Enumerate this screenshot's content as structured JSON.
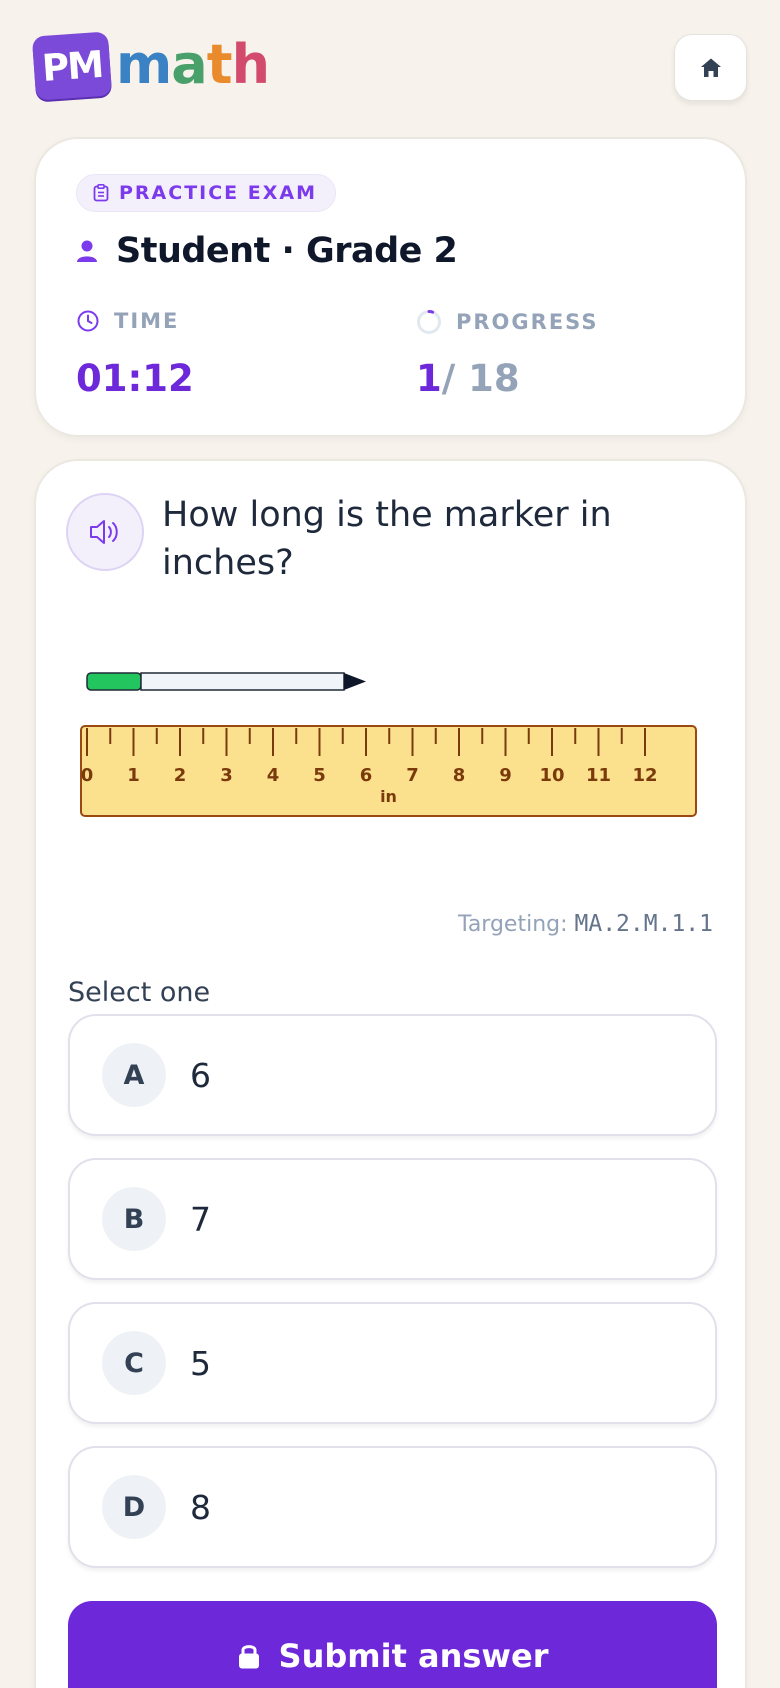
{
  "header": {
    "logo_badge": "PM",
    "logo_word": [
      "m",
      "a",
      "t",
      "h"
    ],
    "home_icon": "home-icon"
  },
  "exam": {
    "type_label": "PRACTICE EXAM",
    "student": "Student · Grade 2",
    "time_label": "TIME",
    "time_value": "01:12",
    "progress_label": "PROGRESS",
    "progress_current": "1",
    "progress_total": "/ 18",
    "progress_fraction": 0.056
  },
  "question": {
    "text": "How long is the marker in inches?",
    "ruler_unit": "in",
    "ruler_ticks": [
      "0",
      "1",
      "2",
      "3",
      "4",
      "5",
      "6",
      "7",
      "8",
      "9",
      "10",
      "11",
      "12"
    ],
    "marker_length_in": 6,
    "targeting_label": "Targeting:",
    "targeting_code": "MA.2.M.1.1",
    "select_label": "Select one",
    "options": [
      {
        "letter": "A",
        "text": "6"
      },
      {
        "letter": "B",
        "text": "7"
      },
      {
        "letter": "C",
        "text": "5"
      },
      {
        "letter": "D",
        "text": "8"
      }
    ],
    "submit_label": "Submit answer"
  },
  "colors": {
    "accent": "#6d28d9",
    "background": "#f7f3ec",
    "ruler_fill": "#fbe18e",
    "ruler_stroke": "#9a4a10",
    "marker_cap": "#22c55e"
  }
}
